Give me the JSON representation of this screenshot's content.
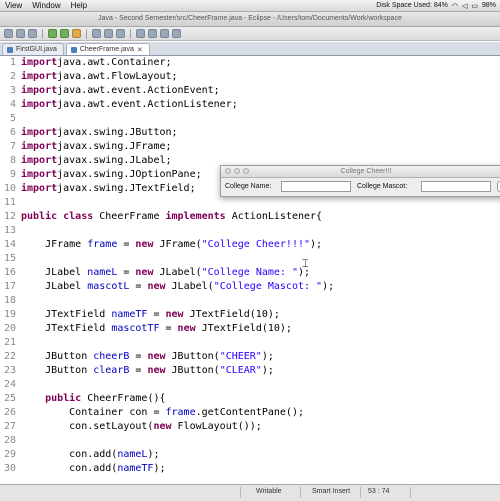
{
  "menubar": {
    "items": [
      "View",
      "Window",
      "Help"
    ],
    "disk_space": "Disk Space Used: 84%",
    "battery": "98%"
  },
  "window": {
    "title": "Java - Second Semester/src/CheerFrame.java - Eclipse - /Users/tom/Documents/Work/workspace"
  },
  "tabs": [
    {
      "label": "FirstGUI.java",
      "active": false
    },
    {
      "label": "CheerFrame.java",
      "active": true,
      "close": "✕"
    }
  ],
  "editor": {
    "lines": [
      {
        "n": "1",
        "tokens": [
          [
            "kw",
            "import"
          ],
          [
            "",
            "java.awt.Container;"
          ]
        ]
      },
      {
        "n": "2",
        "tokens": [
          [
            "kw",
            "import"
          ],
          [
            "",
            "java.awt.FlowLayout;"
          ]
        ]
      },
      {
        "n": "3",
        "tokens": [
          [
            "kw",
            "import"
          ],
          [
            "",
            "java.awt.event.ActionEvent;"
          ]
        ]
      },
      {
        "n": "4",
        "tokens": [
          [
            "kw",
            "import"
          ],
          [
            "",
            "java.awt.event.ActionListener;"
          ]
        ]
      },
      {
        "n": "5",
        "tokens": []
      },
      {
        "n": "6",
        "tokens": [
          [
            "kw",
            "import"
          ],
          [
            "",
            "javax.swing.JButton;"
          ]
        ]
      },
      {
        "n": "7",
        "tokens": [
          [
            "kw",
            "import"
          ],
          [
            "",
            "javax.swing.JFrame;"
          ]
        ]
      },
      {
        "n": "8",
        "tokens": [
          [
            "kw",
            "import"
          ],
          [
            "",
            "javax.swing.JLabel;"
          ]
        ]
      },
      {
        "n": "9",
        "tokens": [
          [
            "kw",
            "import"
          ],
          [
            "",
            "javax.swing.JOptionPane;"
          ]
        ]
      },
      {
        "n": "10",
        "tokens": [
          [
            "kw",
            "import"
          ],
          [
            "",
            "javax.swing.JTextField;"
          ]
        ]
      },
      {
        "n": "11",
        "tokens": []
      },
      {
        "n": "12",
        "tokens": [
          [
            "kw",
            "public class"
          ],
          [
            "",
            " CheerFrame "
          ],
          [
            "kw",
            "implements"
          ],
          [
            "",
            " ActionListener{"
          ]
        ]
      },
      {
        "n": "13",
        "tokens": []
      },
      {
        "n": "14",
        "tokens": [
          [
            "",
            "    JFrame "
          ],
          [
            "fld",
            "frame"
          ],
          [
            "",
            " = "
          ],
          [
            "kw",
            "new"
          ],
          [
            "",
            " JFrame("
          ],
          [
            "str",
            "\"College Cheer!!!\""
          ],
          [
            "",
            ");"
          ]
        ]
      },
      {
        "n": "15",
        "tokens": []
      },
      {
        "n": "16",
        "tokens": [
          [
            "",
            "    JLabel "
          ],
          [
            "fld",
            "nameL"
          ],
          [
            "",
            " = "
          ],
          [
            "kw",
            "new"
          ],
          [
            "",
            " JLabel("
          ],
          [
            "str",
            "\"College Name: \""
          ],
          [
            "",
            ");"
          ]
        ]
      },
      {
        "n": "17",
        "tokens": [
          [
            "",
            "    JLabel "
          ],
          [
            "fld",
            "mascotL"
          ],
          [
            "",
            " = "
          ],
          [
            "kw",
            "new"
          ],
          [
            "",
            " JLabel("
          ],
          [
            "str",
            "\"College Mascot: \""
          ],
          [
            "",
            ");"
          ]
        ]
      },
      {
        "n": "18",
        "tokens": []
      },
      {
        "n": "19",
        "tokens": [
          [
            "",
            "    JTextField "
          ],
          [
            "fld",
            "nameTF"
          ],
          [
            "",
            " = "
          ],
          [
            "kw",
            "new"
          ],
          [
            "",
            " JTextField(10);"
          ]
        ]
      },
      {
        "n": "20",
        "tokens": [
          [
            "",
            "    JTextField "
          ],
          [
            "fld",
            "mascotTF"
          ],
          [
            "",
            " = "
          ],
          [
            "kw",
            "new"
          ],
          [
            "",
            " JTextField(10);"
          ]
        ]
      },
      {
        "n": "21",
        "tokens": []
      },
      {
        "n": "22",
        "tokens": [
          [
            "",
            "    JButton "
          ],
          [
            "fld",
            "cheerB"
          ],
          [
            "",
            " = "
          ],
          [
            "kw",
            "new"
          ],
          [
            "",
            " JButton("
          ],
          [
            "str",
            "\"CHEER\""
          ],
          [
            "",
            ");"
          ]
        ]
      },
      {
        "n": "23",
        "tokens": [
          [
            "",
            "    JButton "
          ],
          [
            "fld",
            "clearB"
          ],
          [
            "",
            " = "
          ],
          [
            "kw",
            "new"
          ],
          [
            "",
            " JButton("
          ],
          [
            "str",
            "\"CLEAR\""
          ],
          [
            "",
            ");"
          ]
        ]
      },
      {
        "n": "24",
        "tokens": []
      },
      {
        "n": "25",
        "tokens": [
          [
            "kw",
            "    public"
          ],
          [
            "",
            " CheerFrame(){"
          ]
        ]
      },
      {
        "n": "26",
        "tokens": [
          [
            "",
            "        Container con = "
          ],
          [
            "fld",
            "frame"
          ],
          [
            "",
            ".getContentPane();"
          ]
        ]
      },
      {
        "n": "27",
        "tokens": [
          [
            "",
            "        con.setLayout("
          ],
          [
            "kw",
            "new"
          ],
          [
            "",
            " FlowLayout());"
          ]
        ]
      },
      {
        "n": "28",
        "tokens": []
      },
      {
        "n": "29",
        "tokens": [
          [
            "",
            "        con.add("
          ],
          [
            "fld",
            "nameL"
          ],
          [
            "",
            ");"
          ]
        ]
      },
      {
        "n": "30",
        "tokens": [
          [
            "",
            "        con.add("
          ],
          [
            "fld",
            "nameTF"
          ],
          [
            "",
            ");"
          ]
        ]
      }
    ]
  },
  "floating_window": {
    "title": "College Cheer!!!",
    "name_label": "College Name:",
    "mascot_label": "College Mascot:"
  },
  "statusbar": {
    "mode": "Writable",
    "insert": "Smart Insert",
    "position": "53 : 74"
  },
  "colors": {
    "keyword": "#7f0055",
    "string": "#2a00ff",
    "field": "#0000c0",
    "line_number": "#8a8a8a"
  }
}
